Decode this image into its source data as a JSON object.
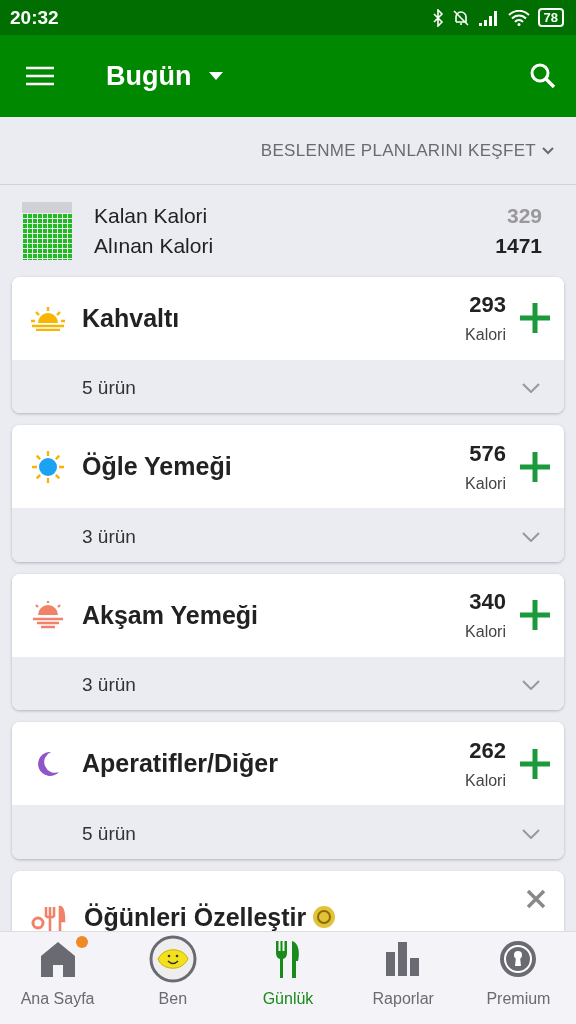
{
  "status_bar": {
    "time": "20:32",
    "battery": "78"
  },
  "app_bar": {
    "title": "Bugün"
  },
  "explore": {
    "label": "BESLENME PLANLARINI KEŞFET"
  },
  "summary": {
    "level": 0.82,
    "rows": [
      {
        "label": "Kalan Kalori",
        "value": "329",
        "kind": "remaining"
      },
      {
        "label": "Alınan Kalori",
        "value": "1471",
        "kind": "consumed"
      }
    ]
  },
  "meals": [
    {
      "kind": "sunrise",
      "title": "Kahvaltı",
      "calories": "293",
      "unit": "Kalori",
      "items": "5 ürün"
    },
    {
      "kind": "sun",
      "title": "Öğle Yemeği",
      "calories": "576",
      "unit": "Kalori",
      "items": "3 ürün"
    },
    {
      "kind": "sunset",
      "title": "Akşam Yemeği",
      "calories": "340",
      "unit": "Kalori",
      "items": "3 ürün"
    },
    {
      "kind": "moon",
      "title": "Aperatifler/Diğer",
      "calories": "262",
      "unit": "Kalori",
      "items": "5 ürün"
    }
  ],
  "promo": {
    "title": "Öğünleri Özelleştir"
  },
  "bottom_nav": [
    {
      "kind": "home",
      "label": "Ana Sayfa",
      "selected": false,
      "notification": true
    },
    {
      "kind": "me",
      "label": "Ben",
      "selected": false,
      "notification": false
    },
    {
      "kind": "diary",
      "label": "Günlük",
      "selected": true,
      "notification": false
    },
    {
      "kind": "reports",
      "label": "Raporlar",
      "selected": false,
      "notification": false
    },
    {
      "kind": "premium",
      "label": "Premium",
      "selected": false,
      "notification": false
    }
  ]
}
